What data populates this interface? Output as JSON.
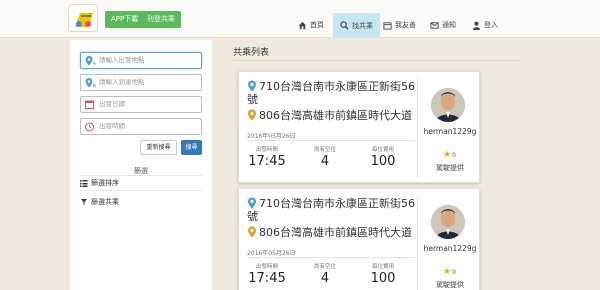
{
  "header": {
    "app_download": "APP下載",
    "register": "刊登共乘",
    "nav": {
      "home": "首頁",
      "find": "找共乘",
      "share": "我友善",
      "notify": "通知",
      "login": "登入"
    },
    "active_color": "#c6e7f2",
    "button_color": "#5cb85c"
  },
  "sidebar": {
    "start_placeholder": "請輸入出發地點",
    "dest_placeholder": "請輸入到達地點",
    "date_placeholder": "出發日期",
    "time_placeholder": "出發時間",
    "reset_label": "重新搜尋",
    "search_label": "搜尋",
    "filter_title": "篩選",
    "filter_sort": "篩選排序",
    "filter_share": "篩選共乘"
  },
  "main": {
    "title": "共乘列表",
    "cards": [
      {
        "from": "710台灣台南市永康區正新街56號",
        "to": "806台灣高雄市前鎮區時代大道",
        "date": "2016年05月26日",
        "depart_label": "出發時間",
        "depart_time": "17:45",
        "seats_label": "尚有空位",
        "seats": "4",
        "fee_label": "每位費用",
        "fee": "100",
        "user": "herman1229g",
        "rating": "0",
        "provider": "駕駛提供"
      },
      {
        "from": "710台灣台南市永康區正新街56號",
        "to": "806台灣高雄市前鎮區時代大道",
        "date": "2016年05月26日",
        "depart_label": "出發時間",
        "depart_time": "17:45",
        "seats_label": "尚有空位",
        "seats": "4",
        "fee_label": "每位費用",
        "fee": "100",
        "user": "herman1229g",
        "rating": "0",
        "provider": "駕駛提供"
      }
    ]
  },
  "icons": {
    "start_pin_color": "#4aa3c7",
    "dest_pin_color": "#e0a030",
    "star_color": "#e0a800"
  }
}
